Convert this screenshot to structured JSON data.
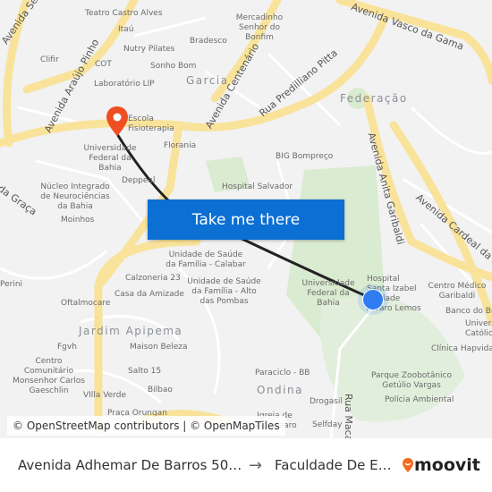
{
  "map": {
    "labels": [
      "Teatro Castro Alves",
      "Itaú",
      "Nutry Pilates",
      "Bradesco",
      "Mercadinho Senhor do Bonfim",
      "Clifir",
      "COT",
      "Sonho Bom",
      "Garcia",
      "Laboratório LIP",
      "Escola Fisioterapia",
      "Universidade Federal da Bahia",
      "Florania",
      "Deppeal",
      "Núcleo Integrado de Neurociências da Bahia",
      "Moinhos",
      "Federação",
      "BIG Bompreço",
      "Hospital Salvador",
      "Unidade de Saúde da Família - Calabar",
      "Calzoneria 23",
      "Casa da Amizade",
      "Unidade de Saúde da Família - Alto das Pombas",
      "Oftalmocare",
      "Jardim Apipema",
      "Maison Beleza",
      "Fgvh",
      "Centro Comunitário Monsenhor Carlos Gaeschlin",
      "Salto 15",
      "Bilbao",
      "VIlla Verde",
      "Universidade Federal da Bahia",
      "Hospital Santa Izabel Unidade Álvaro Lemos",
      "Centro Médico Garibaldi",
      "Banco do Brasil",
      "Universidade Católica",
      "Clínica Hapvida",
      "Paraciclo - BB",
      "Ondina",
      "Drogasil",
      "Selfday",
      "Parque Zoobotânico Getúlio Vargas",
      "Polícia Ambiental",
      "Perini",
      "Igreja de São Lázaro",
      "Praça Orungan"
    ],
    "roads": [
      "Avenida Vasco da Gama",
      "Rua Predilliano Pitta",
      "Avenida Centenário",
      "Avenida Araújo Pinho",
      "Avenida Anita Garibaldi",
      "Avenida Cardeal da Silva",
      "Rua Macapá",
      "Avenida Sete",
      "da Graça"
    ],
    "route_color": "#222222",
    "origin_color": "#2f7cf0",
    "destination_color": "#f04e23"
  },
  "cta": {
    "label": "Take me there"
  },
  "attribution": "© OpenStreetMap contributors | © OpenMapTiles",
  "footer": {
    "from": "Avenida Adhemar De Barros 50…",
    "arrow_icon": "arrow-right-icon",
    "to": "Faculdade De E…",
    "brand": "moovit",
    "brand_color": "#f26b21"
  }
}
